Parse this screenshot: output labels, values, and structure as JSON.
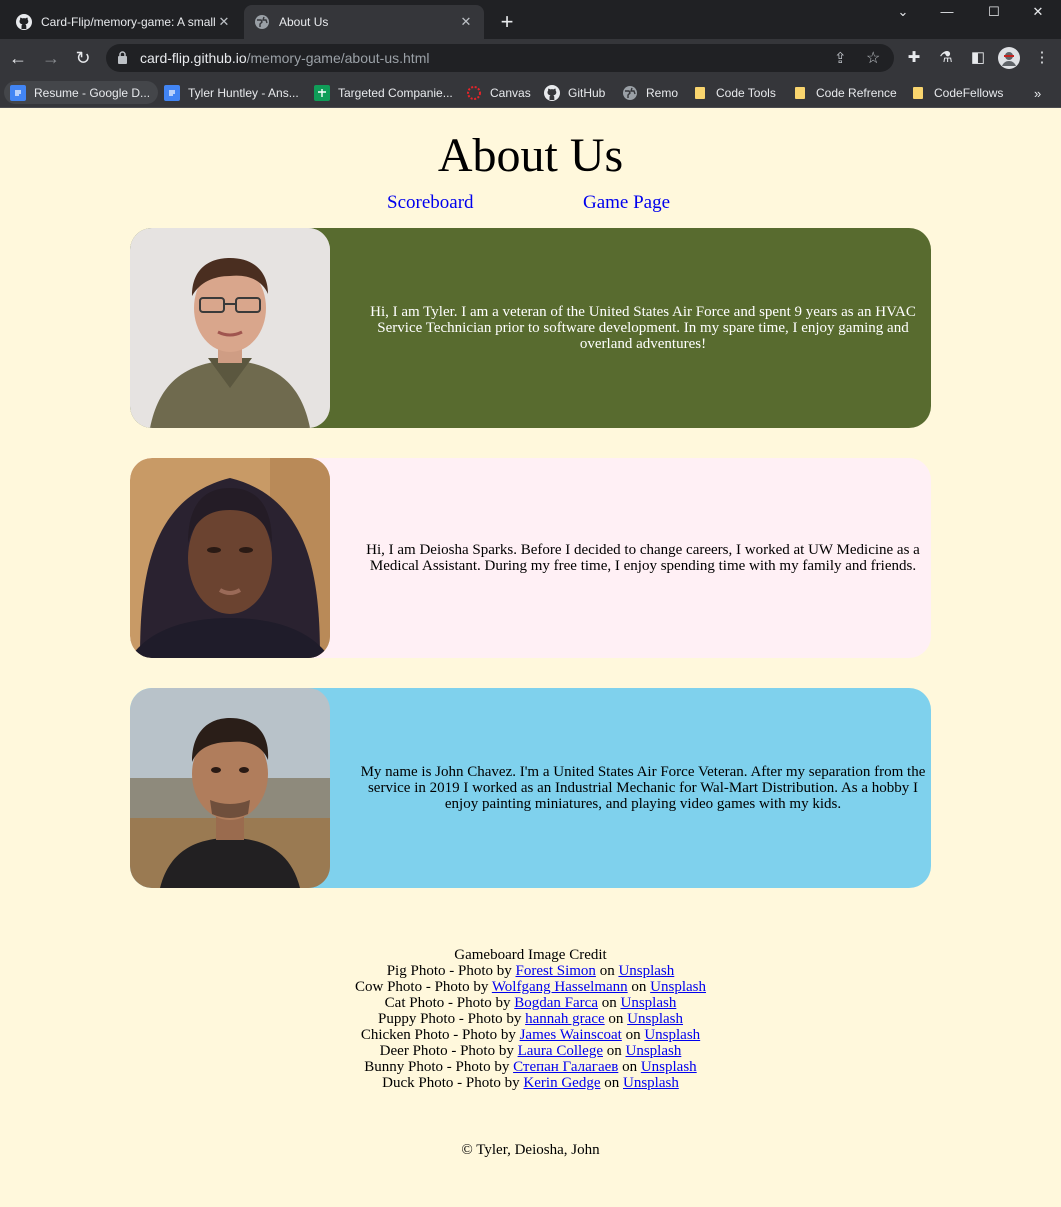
{
  "browser": {
    "tabs": [
      {
        "title": "Card-Flip/memory-game: A small",
        "icon": "github-icon",
        "active": false
      },
      {
        "title": "About Us",
        "icon": "globe-icon",
        "active": true
      }
    ],
    "url_host": "card-flip.github.io",
    "url_path": "/memory-game/about-us.html",
    "bookmarks": [
      {
        "label": "Resume - Google D...",
        "icon": "google-docs-icon",
        "color": "#4285f4"
      },
      {
        "label": "Tyler Huntley - Ans...",
        "icon": "google-docs-icon",
        "color": "#4285f4"
      },
      {
        "label": "Targeted Companie...",
        "icon": "google-sheets-icon",
        "color": "#0f9d58"
      },
      {
        "label": "Canvas",
        "icon": "canvas-icon",
        "color": "#e72429"
      },
      {
        "label": "GitHub",
        "icon": "github-icon",
        "color": "#ffffff"
      },
      {
        "label": "Remo",
        "icon": "globe-icon",
        "color": "#9aa0a6"
      },
      {
        "label": "Code Tools",
        "icon": "folder-icon",
        "color": "#f9d56e"
      },
      {
        "label": "Code Refrence",
        "icon": "folder-icon",
        "color": "#f9d56e"
      },
      {
        "label": "CodeFellows",
        "icon": "folder-icon",
        "color": "#f9d56e"
      }
    ]
  },
  "page": {
    "title": "About Us",
    "nav": [
      {
        "label": "Scoreboard"
      },
      {
        "label": "Game Page"
      }
    ],
    "cards": [
      {
        "name": "Tyler",
        "bg": "#586b2f",
        "text_color": "#ffffff",
        "bio": "Hi, I am Tyler. I am a veteran of the United States Air Force and spent 9 years as an HVAC Service Technician prior to software development. In my spare time, I enjoy gaming and overland adventures!"
      },
      {
        "name": "Deiosha",
        "bg": "#fff0f5",
        "text_color": "#000000",
        "bio": "Hi, I am Deiosha Sparks. Before I decided to change careers, I worked at UW Medicine as a Medical Assistant. During my free time, I enjoy spending time with my family and friends."
      },
      {
        "name": "John",
        "bg": "#7fd1ed",
        "text_color": "#000000",
        "bio": "My name is John Chavez. I'm a United States Air Force Veteran. After my separation from the service in 2019 I worked as an Industrial Mechanic for Wal-Mart Distribution. As a hobby I enjoy painting miniatures, and playing video games with my kids."
      }
    ],
    "credits": {
      "heading": "Gameboard Image Credit",
      "lines": [
        {
          "prefix": "Pig Photo - Photo by ",
          "author": "Forest Simon",
          "on": " on ",
          "site": "Unsplash"
        },
        {
          "prefix": "Cow Photo - Photo by ",
          "author": "Wolfgang Hasselmann",
          "on": " on ",
          "site": "Unsplash"
        },
        {
          "prefix": "Cat Photo - Photo by ",
          "author": "Bogdan Farca",
          "on": " on ",
          "site": "Unsplash"
        },
        {
          "prefix": "Puppy Photo - Photo by ",
          "author": "hannah grace",
          "on": " on ",
          "site": "Unsplash"
        },
        {
          "prefix": "Chicken Photo - Photo by ",
          "author": "James Wainscoat",
          "on": " on ",
          "site": "Unsplash"
        },
        {
          "prefix": "Deer Photo - Photo by ",
          "author": "Laura College",
          "on": " on ",
          "site": "Unsplash"
        },
        {
          "prefix": "Bunny Photo - Photo by ",
          "author": "Степан Галагаев",
          "on": " on ",
          "site": "Unsplash"
        },
        {
          "prefix": "Duck Photo - Photo by ",
          "author": "Kerin Gedge",
          "on": " on ",
          "site": "Unsplash"
        }
      ]
    },
    "footer": "© Tyler, Deiosha, John"
  }
}
